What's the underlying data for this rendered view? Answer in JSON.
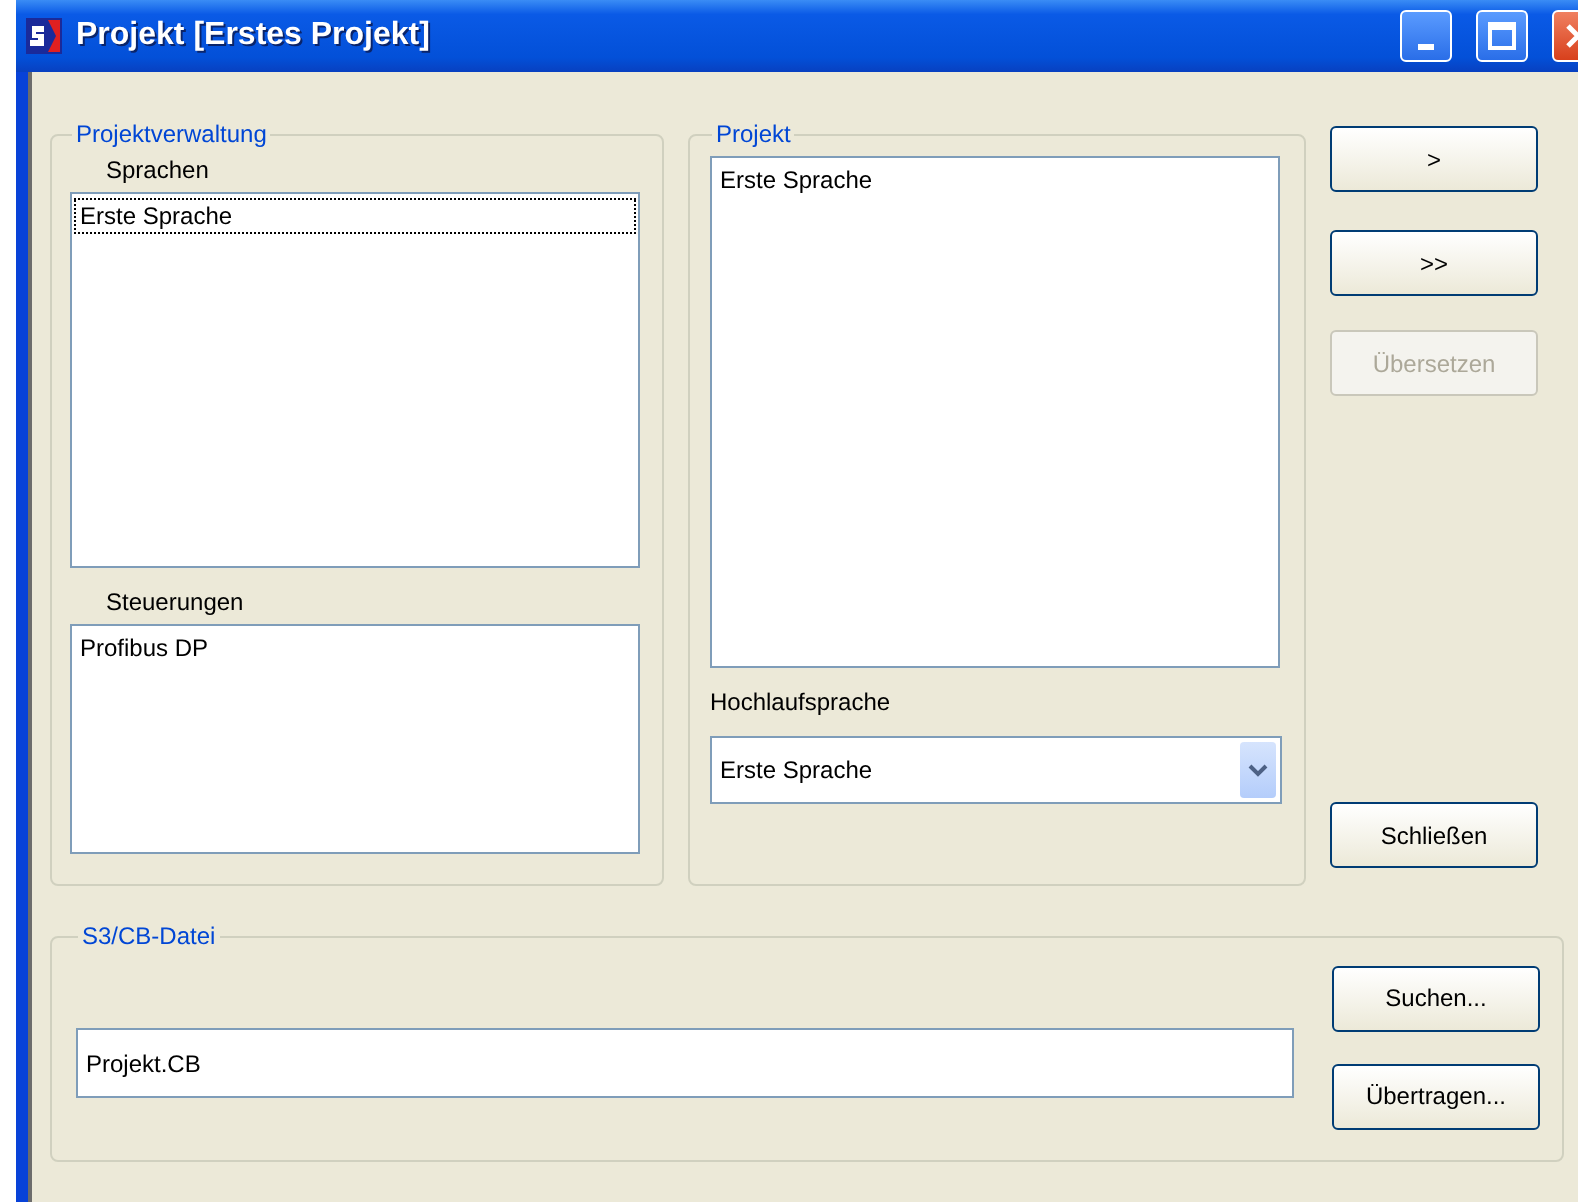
{
  "window": {
    "title": "Projekt [Erstes Projekt]"
  },
  "projektverwaltung": {
    "legend": "Projektverwaltung",
    "sprachen": {
      "label": "Sprachen",
      "items": [
        {
          "text": "Erste Sprache",
          "focused": true
        }
      ]
    },
    "steuerungen": {
      "label": "Steuerungen",
      "items": [
        {
          "text": "Profibus DP",
          "focused": false
        }
      ]
    }
  },
  "projekt": {
    "legend": "Projekt",
    "items": [
      {
        "text": "Erste Sprache",
        "focused": false
      }
    ],
    "hochlaufsprache": {
      "label": "Hochlaufsprache",
      "value": "Erste Sprache"
    }
  },
  "side_buttons": [
    {
      "label": ">",
      "disabled": false
    },
    {
      "label": ">>",
      "disabled": false
    },
    {
      "label": "Übersetzen",
      "disabled": true
    }
  ],
  "close_button": {
    "label": "Schließen",
    "disabled": false
  },
  "datei": {
    "legend": "S3/CB-Datei",
    "value": "Projekt.CB",
    "buttons": [
      {
        "label": "Suchen...",
        "disabled": false
      },
      {
        "label": "Übertragen...",
        "disabled": false
      }
    ]
  }
}
